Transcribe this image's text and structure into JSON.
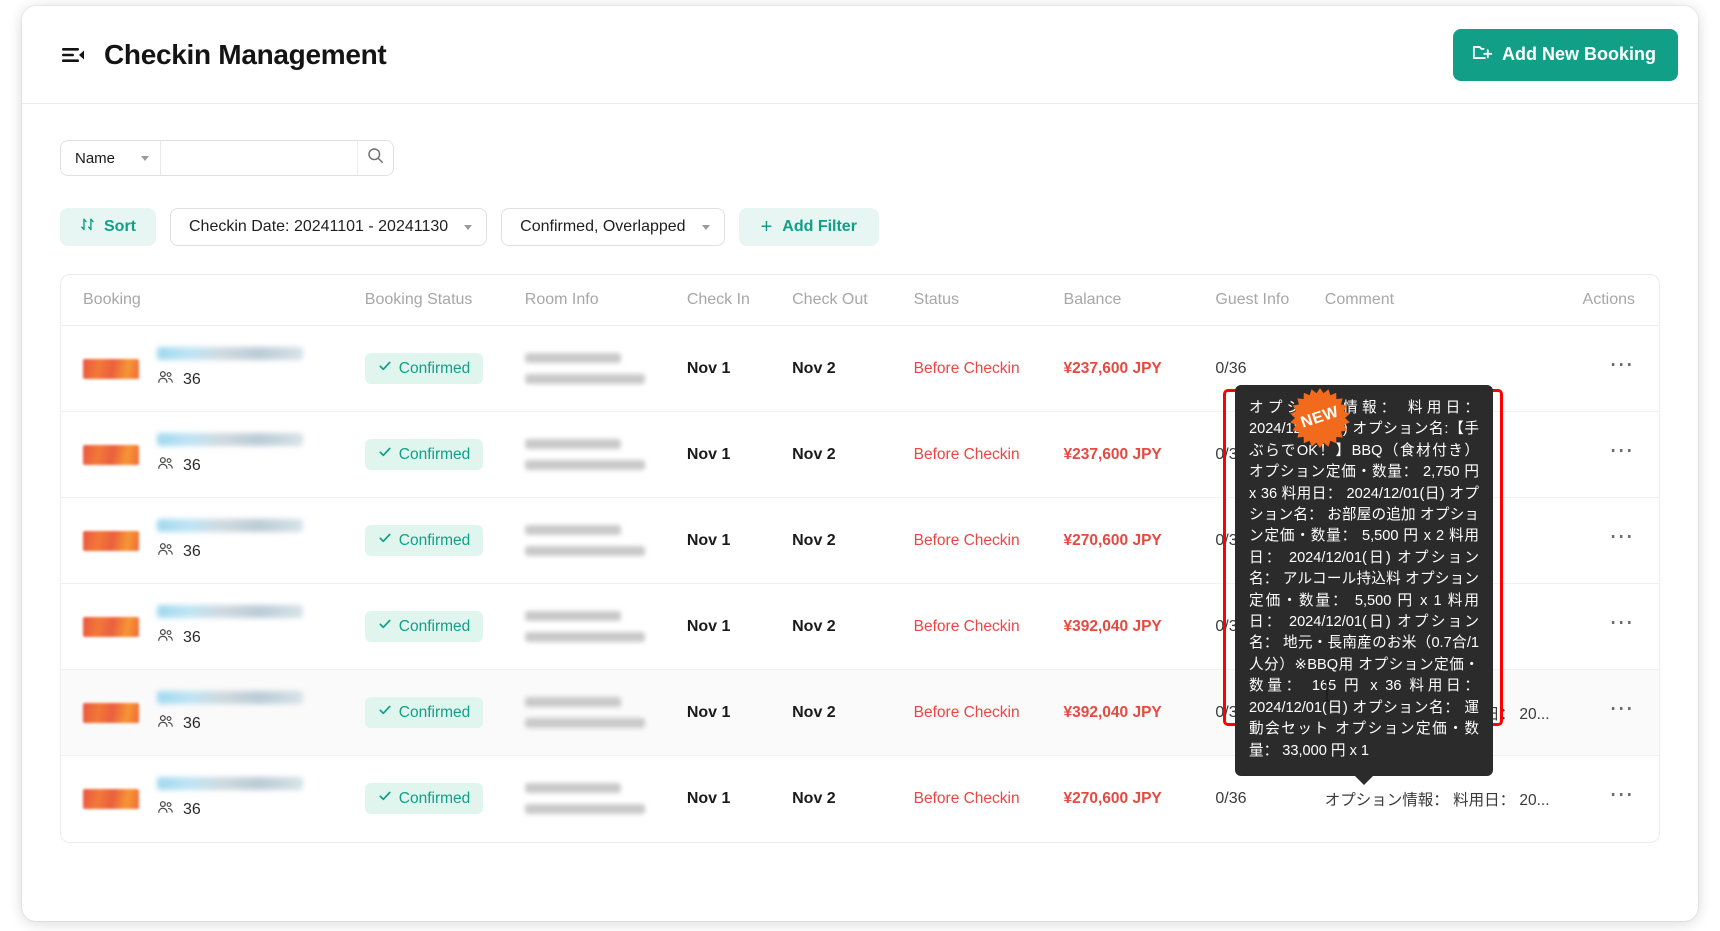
{
  "header": {
    "title": "Checkin Management",
    "menu_icon": "menu-collapse-icon",
    "add_booking_label": "Add New Booking",
    "add_booking_icon": "folder-plus-icon",
    "accent_color": "#11a087"
  },
  "search": {
    "field_label": "Name",
    "value": "",
    "placeholder": "",
    "search_icon": "search-icon",
    "chevron_icon": "chevron-down-icon"
  },
  "filters": {
    "sort_label": "Sort",
    "sort_icon": "sort-icon",
    "chips": [
      {
        "label": "Checkin Date: 20241101 - 20241130"
      },
      {
        "label": "Confirmed, Overlapped"
      }
    ],
    "add_filter_label": "Add Filter",
    "add_filter_icon": "plus-icon"
  },
  "table": {
    "columns": [
      "Booking",
      "Booking Status",
      "Room Info",
      "Check In",
      "Check Out",
      "Status",
      "Balance",
      "Guest Info",
      "Comment",
      "Actions"
    ],
    "rows": [
      {
        "guests": "36",
        "booking_status": "Confirmed",
        "check_in": "Nov 1",
        "check_out": "Nov 2",
        "status": "Before Checkin",
        "balance": "¥237,600 JPY",
        "guest_info": "0/36",
        "comment": "",
        "actions_icon": "ellipsis-icon"
      },
      {
        "guests": "36",
        "booking_status": "Confirmed",
        "check_in": "Nov 1",
        "check_out": "Nov 2",
        "status": "Before Checkin",
        "balance": "¥237,600 JPY",
        "guest_info": "0/36",
        "comment": "",
        "actions_icon": "ellipsis-icon"
      },
      {
        "guests": "36",
        "booking_status": "Confirmed",
        "check_in": "Nov 1",
        "check_out": "Nov 2",
        "status": "Before Checkin",
        "balance": "¥270,600 JPY",
        "guest_info": "0/36",
        "comment": "",
        "actions_icon": "ellipsis-icon"
      },
      {
        "guests": "36",
        "booking_status": "Confirmed",
        "check_in": "Nov 1",
        "check_out": "Nov 2",
        "status": "Before Checkin",
        "balance": "¥392,040 JPY",
        "guest_info": "0/36",
        "comment": "",
        "actions_icon": "ellipsis-icon"
      },
      {
        "guests": "36",
        "booking_status": "Confirmed",
        "check_in": "Nov 1",
        "check_out": "Nov 2",
        "status": "Before Checkin",
        "balance": "¥392,040 JPY",
        "guest_info": "0/36",
        "comment": "オプション情報： 料用日： 20...",
        "actions_icon": "ellipsis-icon"
      },
      {
        "guests": "36",
        "booking_status": "Confirmed",
        "check_in": "Nov 1",
        "check_out": "Nov 2",
        "status": "Before Checkin",
        "balance": "¥270,600 JPY",
        "guest_info": "0/36",
        "comment": "オプション情報： 料用日： 20...",
        "actions_icon": "ellipsis-icon"
      }
    ]
  },
  "new_badge": {
    "label": "NEW",
    "color": "#f26a1b"
  },
  "tooltip": {
    "text": "オプション情報： 料用日： 2024/12/01(日) オプション名:【手ぶらでOK！】BBQ（食材付き） オプション定価・数量： 2,750 円 x 36 料用日： 2024/12/01(日) オプション名： お部屋の追加 オプション定価・数量： 5,500 円 x 2 料用日： 2024/12/01(日) オプション名： アルコール持込料 オプション定価・数量： 5,500 円 x 1 料用日： 2024/12/01(日) オプション名： 地元・長南産のお米（0.7合/1人分）※BBQ用 オプション定価・数量： 165 円 x 36 料用日： 2024/12/01(日) オプション名： 運動会セット オプション定価・数量： 33,000 円 x 1",
    "background": "#2b2b2b",
    "highlight_color": "#ff0000"
  },
  "status_colors": {
    "before_checkin": "#ef4444",
    "balance": "#e8483f",
    "confirmed": "#11a087"
  }
}
